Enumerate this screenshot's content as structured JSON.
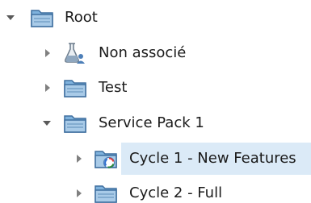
{
  "tree": {
    "root": {
      "label": "Root",
      "expanded": true,
      "icon": "folder-icon"
    },
    "children": [
      {
        "label": "Non associé",
        "expanded": false,
        "icon": "flask-user-icon"
      },
      {
        "label": "Test",
        "expanded": false,
        "icon": "folder-icon"
      },
      {
        "label": "Service Pack 1",
        "expanded": true,
        "icon": "folder-icon",
        "children": [
          {
            "label": "Cycle 1 - New Features",
            "expanded": false,
            "icon": "cycle-folder-icon",
            "selected": true
          },
          {
            "label": "Cycle 2 - Full",
            "expanded": false,
            "icon": "folder-icon"
          }
        ]
      }
    ]
  },
  "colors": {
    "selection": "#dbeaf7",
    "folder_fill": "#a9cbe8",
    "folder_stroke": "#3f6f9f",
    "arrow_expanded": "#5a5a5a",
    "arrow_collapsed": "#808080"
  }
}
